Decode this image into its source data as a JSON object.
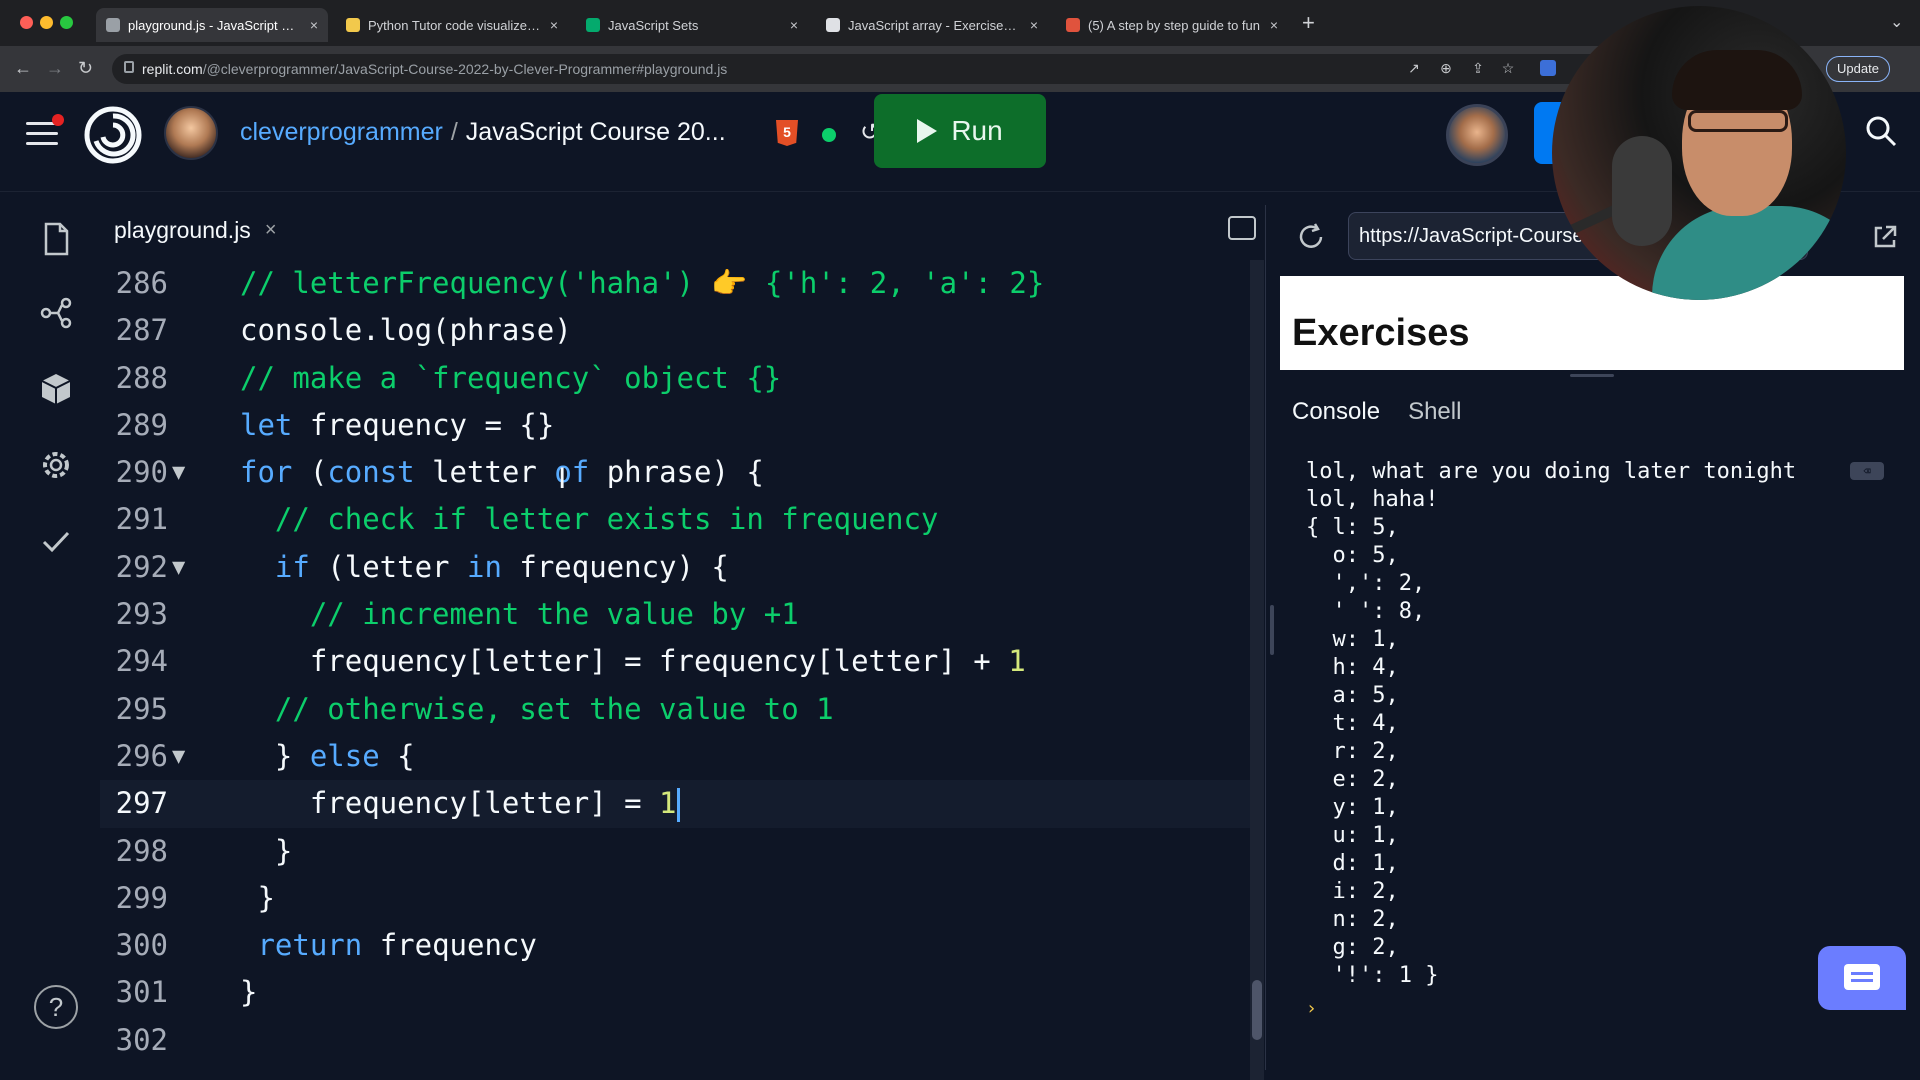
{
  "browser": {
    "tabs": [
      {
        "label": "playground.js - JavaScript Cou",
        "favicon": "#9aa0a6",
        "active": true
      },
      {
        "label": "Python Tutor code visualizer: V",
        "favicon": "#f2c94c",
        "active": false
      },
      {
        "label": "JavaScript Sets",
        "favicon": "#04aa6d",
        "active": false
      },
      {
        "label": "JavaScript array - Exercises, P",
        "favicon": "#dfe1e5",
        "active": false
      },
      {
        "label": "(5) A step by step guide to fun",
        "favicon": "#e0533d",
        "active": false
      }
    ],
    "url_host": "replit.com",
    "url_path": "/@cleverprogrammer/JavaScript-Course-2022-by-Clever-Programmer#playground.js",
    "update_label": "Update"
  },
  "header": {
    "owner": "cleverprogrammer",
    "separator": "/",
    "repl_name": "JavaScript Course 20...",
    "run_label": "Run",
    "html5_label": "5"
  },
  "editor": {
    "filename": "playground.js",
    "close_glyph": "×",
    "lines": [
      {
        "n": "286",
        "tokens": [
          {
            "t": "// letterFrequency('haha') 👉 {'h': 2, 'a': 2}",
            "c": "com"
          }
        ]
      },
      {
        "n": "287",
        "tokens": [
          {
            "t": "console.log(phrase)",
            "c": "txt"
          }
        ]
      },
      {
        "n": "288",
        "tokens": [
          {
            "t": "// make a `frequency` object {}",
            "c": "com"
          }
        ]
      },
      {
        "n": "289",
        "tokens": [
          {
            "t": "let",
            "c": "kw"
          },
          {
            "t": " frequency = {}",
            "c": "txt"
          }
        ]
      },
      {
        "n": "290",
        "fold": true,
        "tokens": [
          {
            "t": "for",
            "c": "kw"
          },
          {
            "t": " (",
            "c": "txt"
          },
          {
            "t": "const",
            "c": "kw"
          },
          {
            "t": " letter ",
            "c": "txt"
          },
          {
            "t": "of",
            "c": "kw"
          },
          {
            "t": " phrase) {",
            "c": "txt"
          }
        ]
      },
      {
        "n": "291",
        "tokens": [
          {
            "t": "  // check if letter exists in frequency",
            "c": "com"
          }
        ]
      },
      {
        "n": "292",
        "fold": true,
        "tokens": [
          {
            "t": "  ",
            "c": "txt"
          },
          {
            "t": "if",
            "c": "kw"
          },
          {
            "t": " (letter ",
            "c": "txt"
          },
          {
            "t": "in",
            "c": "kw"
          },
          {
            "t": " frequency) {",
            "c": "txt"
          }
        ]
      },
      {
        "n": "293",
        "tokens": [
          {
            "t": "    // increment the value by +1",
            "c": "com"
          }
        ]
      },
      {
        "n": "294",
        "tokens": [
          {
            "t": "    frequency[letter] = frequency[letter] + ",
            "c": "txt"
          },
          {
            "t": "1",
            "c": "num"
          }
        ]
      },
      {
        "n": "295",
        "tokens": [
          {
            "t": "  // otherwise, set the value to 1",
            "c": "com"
          }
        ]
      },
      {
        "n": "296",
        "fold": true,
        "tokens": [
          {
            "t": "  } ",
            "c": "txt"
          },
          {
            "t": "else",
            "c": "kw"
          },
          {
            "t": " {",
            "c": "txt"
          }
        ]
      },
      {
        "n": "297",
        "current": true,
        "tokens": [
          {
            "t": "    frequency[letter] = ",
            "c": "txt"
          },
          {
            "t": "1",
            "c": "num"
          }
        ]
      },
      {
        "n": "298",
        "tokens": [
          {
            "t": "  }",
            "c": "txt"
          }
        ]
      },
      {
        "n": "299",
        "tokens": [
          {
            "t": " }",
            "c": "txt"
          }
        ]
      },
      {
        "n": "300",
        "tokens": [
          {
            "t": " ",
            "c": "txt"
          },
          {
            "t": "return",
            "c": "kw"
          },
          {
            "t": " frequency",
            "c": "txt"
          }
        ]
      },
      {
        "n": "301",
        "tokens": [
          {
            "t": "}",
            "c": "txt"
          }
        ]
      },
      {
        "n": "302",
        "tokens": []
      }
    ],
    "colors": {
      "kw": "#57abff",
      "com": "#0cce6b",
      "txt": "#f5f9fc",
      "num": "#d4e87c"
    }
  },
  "webview": {
    "url": "https://JavaScript-Course-2022-by-Clever-Programmer",
    "page_heading": "Exercises"
  },
  "console": {
    "tabs": [
      "Console",
      "Shell"
    ],
    "active_tab": "Console",
    "clear_glyph": "⌫",
    "lines": [
      "lol, what are you doing later tonight",
      "lol, haha!",
      "{ l: 5,",
      "  o: 5,",
      "  ',': 2,",
      "  ' ': 8,",
      "  w: 1,",
      "  h: 4,",
      "  a: 5,",
      "  t: 4,",
      "  r: 2,",
      "  e: 2,",
      "  y: 1,",
      "  u: 1,",
      "  d: 1,",
      "  i: 2,",
      "  n: 2,",
      "  g: 2,",
      "  '!': 1 }"
    ],
    "prompt": "›"
  },
  "icons": {
    "sidebar": [
      "files-icon",
      "git-icon",
      "packages-icon",
      "settings-icon",
      "check-icon"
    ],
    "help_label": "?"
  }
}
